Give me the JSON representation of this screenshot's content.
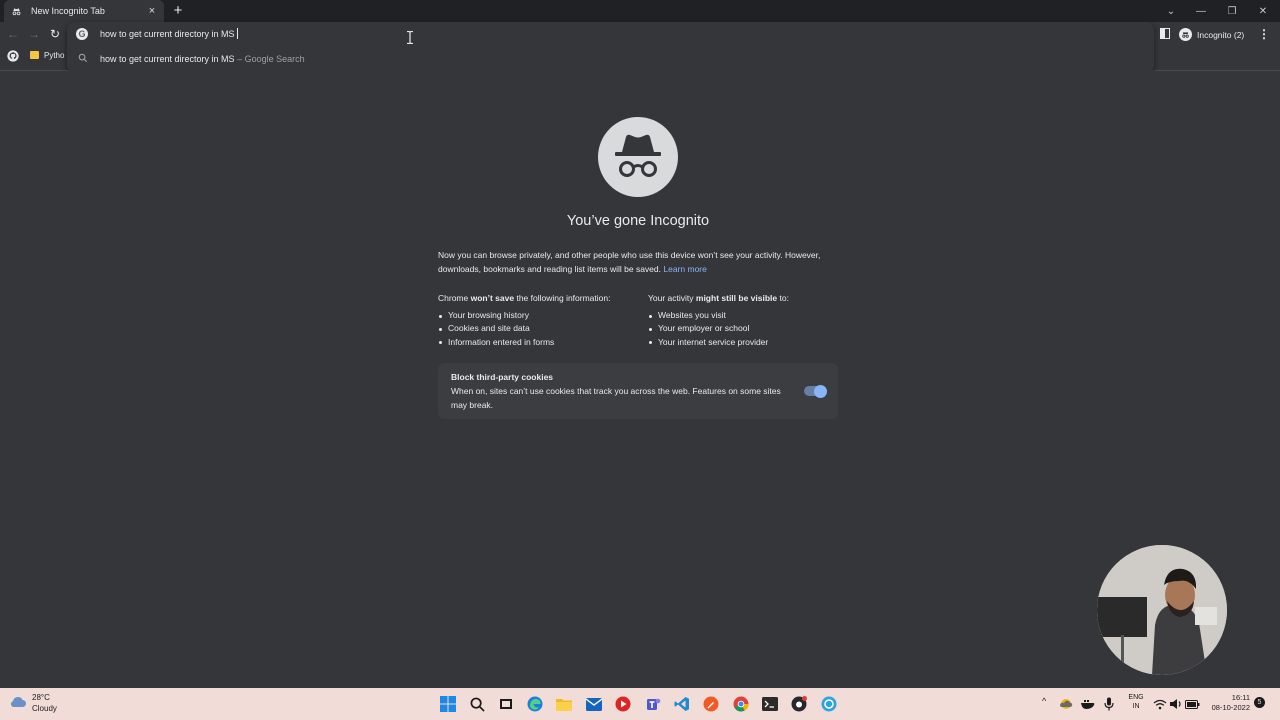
{
  "browser": {
    "tab": {
      "title": "New Incognito Tab",
      "close_symbol": "×"
    },
    "new_tab_symbol": "+",
    "window_controls": {
      "tab_search": "⌄",
      "minimize": "—",
      "restore": "❐",
      "close": "✕"
    },
    "nav": {
      "back": "←",
      "forward": "→",
      "reload": "↻"
    },
    "omnibox": {
      "value": "how to get current directory in MS",
      "suggestion_query": "how to get current directory in MS",
      "suggestion_suffix": " – Google Search"
    },
    "profile_label": "Incognito (2)",
    "menu_symbol": "⋮",
    "bookmark_label": "Pytho"
  },
  "page": {
    "heading": "You’ve gone Incognito",
    "intro": "Now you can browse privately, and other people who use this device won’t see your activity. However, downloads, bookmarks and reading list items will be saved.",
    "learn_more": "Learn more",
    "not_saved": {
      "lead": "Chrome",
      "emphasis": "won’t save",
      "tail": "the following information:",
      "items": [
        "Your browsing history",
        "Cookies and site data",
        "Information entered in forms"
      ]
    },
    "visible": {
      "lead": "Your activity",
      "emphasis": "might still be visible",
      "tail": "to:",
      "items": [
        "Websites you visit",
        "Your employer or school",
        "Your internet service provider"
      ]
    },
    "cookies": {
      "title": "Block third-party cookies",
      "description": "When on, sites can’t use cookies that track you across the web. Features on some sites may break.",
      "enabled": true
    }
  },
  "taskbar": {
    "weather": {
      "temp": "28°C",
      "condition": "Cloudy"
    },
    "language": {
      "line1": "ENG",
      "line2": "IN"
    },
    "clock": {
      "time": "16:11",
      "date": "08-10-2022"
    },
    "tray_chevron": "^",
    "notification_count": "5",
    "icons": [
      "windows-start",
      "search",
      "task-view",
      "edge",
      "file-explorer",
      "mail",
      "media-player",
      "teams",
      "vs-code",
      "postman",
      "chrome",
      "terminal",
      "github-desktop",
      "edge-beta"
    ]
  },
  "colors": {
    "accent": "#8ab4f8",
    "page_background": "#35363a",
    "tabstrip_background": "#202124",
    "taskbar_background": "#f1dcd8"
  }
}
